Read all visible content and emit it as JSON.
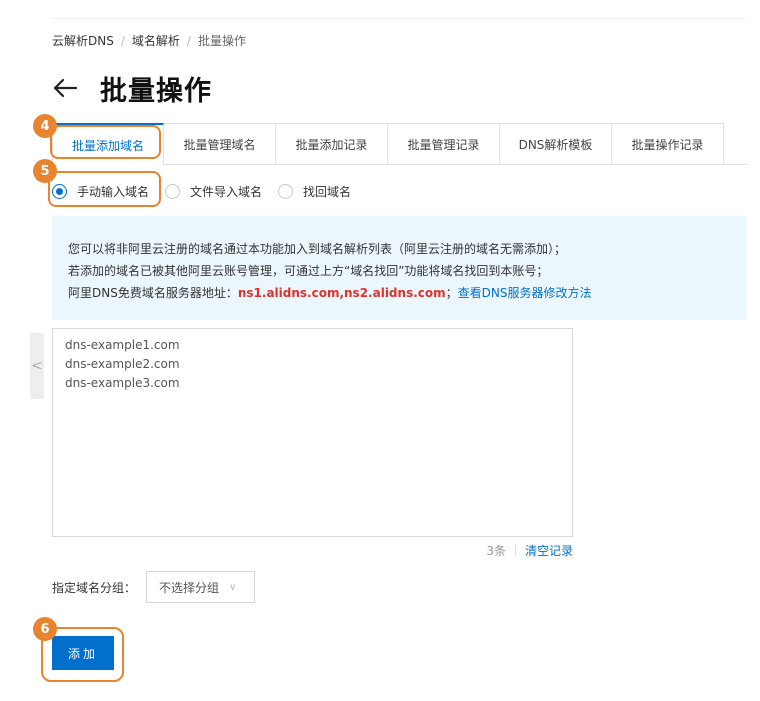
{
  "breadcrumb": [
    "云解析DNS",
    "域名解析",
    "批量操作"
  ],
  "page": {
    "title": "批量操作"
  },
  "tabs": [
    "批量添加域名",
    "批量管理域名",
    "批量添加记录",
    "批量管理记录",
    "DNS解析模板",
    "批量操作记录"
  ],
  "active_tab_index": 0,
  "radio_options": [
    "手动输入域名",
    "文件导入域名",
    "找回域名"
  ],
  "selected_radio_index": 0,
  "notice": {
    "line1": "您可以将非阿里云注册的域名通过本功能加入到域名解析列表（阿里云注册的域名无需添加）；",
    "line2": "若添加的域名已被其他阿里云账号管理，可通过上方“域名找回”功能将域名找回到本账号；",
    "line3_prefix": "阿里DNS免费域名服务器地址：",
    "line3_servers": "ns1.alidns.com,ns2.alidns.com",
    "line3_sep": "；",
    "line3_link": "查看DNS服务器修改方法"
  },
  "domains_input": {
    "value": "dns-example1.com\ndns-example2.com\ndns-example3.com"
  },
  "count": {
    "text": "3条",
    "clear_label": "清空记录"
  },
  "group": {
    "label": "指定域名分组：",
    "selected": "不选择分组"
  },
  "add_button_label": "添加",
  "annotations": [
    {
      "number": "4",
      "target": "tab-batch-add-domain"
    },
    {
      "number": "5",
      "target": "radio-manual-input"
    },
    {
      "number": "6",
      "target": "add-button"
    }
  ],
  "colors": {
    "primary": "#0070cc",
    "highlight": "#e8832f",
    "notice_bg": "#ebf7fd",
    "nameserver_red": "#e0322b"
  },
  "icons": {
    "back": "arrow-left-icon",
    "collapse": "chevron-left-icon",
    "select": "chevron-down-icon"
  }
}
